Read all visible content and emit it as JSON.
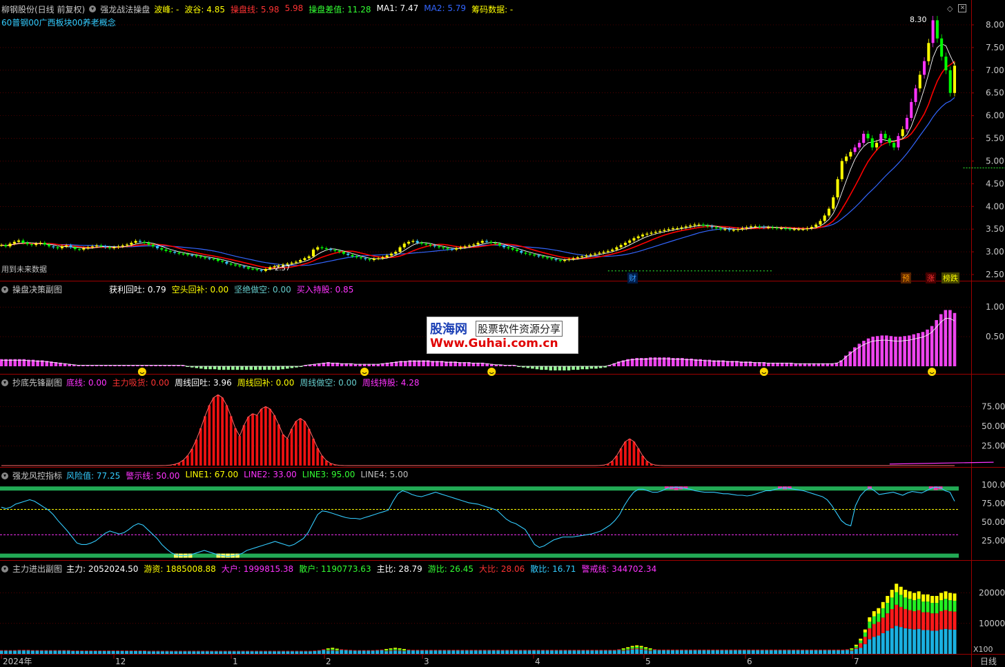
{
  "colors": {
    "bg": "#000000",
    "grid": "#8b0000",
    "axis": "#a00000",
    "up": "#ffff00",
    "down": "#00ff00",
    "magenta": "#ff33ff",
    "red": "#ff0000",
    "cyan": "#33ccff",
    "blue": "#3366ff",
    "white": "#ffffff"
  },
  "main": {
    "stock": "柳钢股份(日线 前复权)",
    "indicator": "强龙战法操盘",
    "items": [
      {
        "label": "波峰: -",
        "color": "#ffff00"
      },
      {
        "label": "波谷: 4.85",
        "color": "#ffff00"
      },
      {
        "label": "操盘线: 5.98",
        "color": "#ff3333"
      },
      {
        "label": "5.98",
        "color": "#ff3333"
      },
      {
        "label": "操盘差值: 11.28",
        "color": "#33ff33"
      },
      {
        "label": "MA1: 7.47",
        "color": "#ffffff"
      },
      {
        "label": "MA2: 5.79",
        "color": "#3366ff"
      },
      {
        "label": "筹码数据: -",
        "color": "#ffff00"
      }
    ],
    "concepts": "60普钢00广西板块00养老概念",
    "future_note": "用到未来数据",
    "peak_label": "8.30",
    "low_label": "2.57",
    "tags": [
      {
        "text": "财",
        "color": "#3399ff"
      },
      {
        "text": "预",
        "color": "#ff9900"
      },
      {
        "text": "涨",
        "color": "#ff3333"
      },
      {
        "text": "榜跌",
        "color": "#ffff00"
      }
    ]
  },
  "sub1": {
    "title": "操盘决策副图",
    "items": [
      {
        "label": "获利回吐: 0.79",
        "color": "#ffffff"
      },
      {
        "label": "空头回补: 0.00",
        "color": "#ffff00"
      },
      {
        "label": "坚绝做空: 0.00",
        "color": "#66cccc"
      },
      {
        "label": "买入持股: 0.85",
        "color": "#ff33ff"
      }
    ]
  },
  "sub2": {
    "title": "抄底先锋副图",
    "items": [
      {
        "label": "底线: 0.00",
        "color": "#ff33ff"
      },
      {
        "label": "主力吸货: 0.00",
        "color": "#ff3333"
      },
      {
        "label": "周线回吐: 3.96",
        "color": "#ffffff"
      },
      {
        "label": "周线回补: 0.00",
        "color": "#ffff00"
      },
      {
        "label": "周线做空: 0.00",
        "color": "#66cccc"
      },
      {
        "label": "周线持股: 4.28",
        "color": "#ff33ff"
      }
    ]
  },
  "sub3": {
    "title": "强龙风控指标",
    "items": [
      {
        "label": "风险值: 77.25",
        "color": "#33ccff"
      },
      {
        "label": "警示线: 50.00",
        "color": "#ff33ff"
      },
      {
        "label": "LINE1: 67.00",
        "color": "#ffff00"
      },
      {
        "label": "LINE2: 33.00",
        "color": "#ff33ff"
      },
      {
        "label": "LINE3: 95.00",
        "color": "#33ff33"
      },
      {
        "label": "LINE4: 5.00",
        "color": "#c0c0c0"
      }
    ]
  },
  "sub4": {
    "title": "主力进出副图",
    "items": [
      {
        "label": "主力: 2052024.50",
        "color": "#ffffff"
      },
      {
        "label": "游资: 1885008.88",
        "color": "#ffff00"
      },
      {
        "label": "大户: 1999815.38",
        "color": "#ff33ff"
      },
      {
        "label": "散户: 1190773.63",
        "color": "#33ff33"
      },
      {
        "label": "主比: 28.79",
        "color": "#ffffff"
      },
      {
        "label": "游比: 26.45",
        "color": "#33ff33"
      },
      {
        "label": "大比: 28.06",
        "color": "#ff3333"
      },
      {
        "label": "散比: 16.71",
        "color": "#33ccff"
      },
      {
        "label": "警戒线: 344702.34",
        "color": "#ff33ff"
      }
    ],
    "unit": "X100"
  },
  "period": "日线",
  "logo": {
    "cn": "股海网",
    "sub": "股票软件资源分享",
    "url": "Www.Guhai.com.cn"
  },
  "chart_data": [
    {
      "panel": "main",
      "type": "candlestick",
      "ylim": [
        2.5,
        8.0
      ],
      "yticks": [
        "8.00",
        "7.50",
        "7.00",
        "6.50",
        "6.00",
        "5.50",
        "5.00",
        "4.50",
        "4.00",
        "3.50",
        "3.00",
        "2.50"
      ],
      "xlabels": [
        "2024年",
        "12",
        "1",
        "2",
        "3",
        "4",
        "5",
        "6",
        "7"
      ],
      "close": [
        3.15,
        3.12,
        3.18,
        3.22,
        3.25,
        3.2,
        3.17,
        3.15,
        3.18,
        3.2,
        3.16,
        3.12,
        3.1,
        3.08,
        3.12,
        3.14,
        3.1,
        3.06,
        3.05,
        3.08,
        3.1,
        3.12,
        3.14,
        3.12,
        3.1,
        3.08,
        3.1,
        3.12,
        3.14,
        3.16,
        3.2,
        3.24,
        3.22,
        3.2,
        3.16,
        3.12,
        3.08,
        3.05,
        3.02,
        3.0,
        2.98,
        2.96,
        2.95,
        2.93,
        2.92,
        2.9,
        2.88,
        2.86,
        2.85,
        2.84,
        2.8,
        2.78,
        2.74,
        2.72,
        2.7,
        2.68,
        2.66,
        2.63,
        2.62,
        2.6,
        2.58,
        2.62,
        2.66,
        2.68,
        2.7,
        2.72,
        2.74,
        2.76,
        2.78,
        2.82,
        2.86,
        2.9,
        3.05,
        3.1,
        3.08,
        3.06,
        3.04,
        3.02,
        3.0,
        2.96,
        2.93,
        2.9,
        2.88,
        2.86,
        2.84,
        2.82,
        2.85,
        2.86,
        2.88,
        2.92,
        2.96,
        3.0,
        3.1,
        3.18,
        3.22,
        3.24,
        3.2,
        3.18,
        3.16,
        3.14,
        3.12,
        3.1,
        3.08,
        3.06,
        3.05,
        3.08,
        3.1,
        3.12,
        3.14,
        3.16,
        3.2,
        3.24,
        3.22,
        3.2,
        3.18,
        3.14,
        3.1,
        3.08,
        3.05,
        3.02,
        2.98,
        2.96,
        2.94,
        2.92,
        2.9,
        2.88,
        2.86,
        2.84,
        2.82,
        2.8,
        2.82,
        2.84,
        2.86,
        2.88,
        2.9,
        2.92,
        2.94,
        2.96,
        2.98,
        3.0,
        3.02,
        3.05,
        3.1,
        3.15,
        3.2,
        3.25,
        3.3,
        3.34,
        3.38,
        3.4,
        3.42,
        3.44,
        3.46,
        3.48,
        3.5,
        3.52,
        3.52,
        3.54,
        3.56,
        3.58,
        3.6,
        3.6,
        3.58,
        3.56,
        3.54,
        3.52,
        3.5,
        3.5,
        3.48,
        3.48,
        3.5,
        3.52,
        3.54,
        3.56,
        3.56,
        3.55,
        3.54,
        3.54,
        3.53,
        3.52,
        3.52,
        3.51,
        3.5,
        3.5,
        3.5,
        3.5,
        3.52,
        3.55,
        3.6,
        3.68,
        3.8,
        3.95,
        4.2,
        4.6,
        5.0,
        5.1,
        5.2,
        5.3,
        5.4,
        5.6,
        5.5,
        5.3,
        5.4,
        5.6,
        5.5,
        5.4,
        5.3,
        5.55,
        5.7,
        5.95,
        6.3,
        6.6,
        6.9,
        7.2,
        7.6,
        8.1,
        7.7,
        7.3,
        7.0,
        6.5,
        7.1
      ]
    },
    {
      "panel": "sub1",
      "type": "bar",
      "ylim": [
        0,
        1.2
      ],
      "yticks": [
        "1.00",
        "0.50"
      ],
      "values": [
        0.12,
        0.12,
        0.12,
        0.12,
        0.12,
        0.12,
        0.11,
        0.11,
        0.1,
        0.1,
        0.09,
        0.08,
        0.07,
        0.06,
        0.05,
        0.04,
        0.03,
        0.02,
        0.02,
        0.02,
        0.02,
        0.02,
        0.02,
        0.02,
        0.02,
        0.02,
        0.02,
        0.02,
        0.02,
        0.02,
        0.02,
        0.02,
        0.02,
        0.02,
        0.02,
        0.02,
        0.02,
        0.02,
        0.02,
        0.02,
        0.02,
        -0.01,
        -0.02,
        -0.03,
        -0.04,
        -0.05,
        -0.05,
        -0.05,
        -0.06,
        -0.06,
        -0.06,
        -0.06,
        -0.06,
        -0.06,
        -0.06,
        -0.06,
        -0.06,
        -0.06,
        -0.06,
        -0.06,
        -0.06,
        -0.06,
        -0.05,
        -0.04,
        -0.03,
        -0.02,
        -0.01,
        0.02,
        0.03,
        0.04,
        0.05,
        0.06,
        0.07,
        0.06,
        0.06,
        0.05,
        0.05,
        0.05,
        0.04,
        0.04,
        0.04,
        0.04,
        0.04,
        0.04,
        0.05,
        0.06,
        0.07,
        0.08,
        0.09,
        0.09,
        0.1,
        0.1,
        0.1,
        0.1,
        0.1,
        0.09,
        0.09,
        0.09,
        0.08,
        0.08,
        0.08,
        0.07,
        0.07,
        0.07,
        0.06,
        0.06,
        0.06,
        0.05,
        0.04,
        0.03,
        0.03,
        0.02,
        0.02,
        0.02,
        -0.01,
        -0.02,
        -0.03,
        -0.04,
        -0.05,
        -0.06,
        -0.06,
        -0.07,
        -0.07,
        -0.07,
        -0.07,
        -0.07,
        -0.06,
        -0.06,
        -0.05,
        -0.05,
        -0.04,
        -0.04,
        -0.03,
        -0.02,
        0.02,
        0.05,
        0.08,
        0.1,
        0.12,
        0.13,
        0.14,
        0.14,
        0.14,
        0.15,
        0.15,
        0.15,
        0.15,
        0.15,
        0.14,
        0.14,
        0.14,
        0.13,
        0.13,
        0.12,
        0.12,
        0.11,
        0.11,
        0.1,
        0.1,
        0.1,
        0.09,
        0.09,
        0.09,
        0.08,
        0.08,
        0.08,
        0.07,
        0.07,
        0.07,
        0.06,
        0.06,
        0.06,
        0.06,
        0.06,
        0.06,
        0.05,
        0.05,
        0.05,
        0.05,
        0.05,
        0.05,
        0.05,
        0.05,
        0.05,
        0.06,
        0.1,
        0.18,
        0.25,
        0.32,
        0.38,
        0.43,
        0.47,
        0.5,
        0.51,
        0.52,
        0.52,
        0.51,
        0.5,
        0.5,
        0.51,
        0.52,
        0.54,
        0.56,
        0.58,
        0.62,
        0.68,
        0.78,
        0.88,
        0.95,
        0.95,
        0.9
      ],
      "smileys_at": [
        31,
        80,
        108,
        168,
        205
      ]
    },
    {
      "panel": "sub2",
      "type": "bar",
      "ylim": [
        0,
        100
      ],
      "yticks": [
        "75.00",
        "50.00",
        "25.00"
      ],
      "peaks": [
        {
          "center": 50,
          "height": 90,
          "width": 5
        },
        {
          "center": 58,
          "height": 66,
          "width": 4
        },
        {
          "center": 61,
          "height": 75,
          "width": 5
        },
        {
          "center": 69,
          "height": 60,
          "width": 4
        },
        {
          "center": 145,
          "height": 34,
          "width": 3
        }
      ]
    },
    {
      "panel": "sub3",
      "type": "line",
      "ylim": [
        0,
        110
      ],
      "yticks": [
        "100.0",
        "75.00",
        "50.00",
        "25.00"
      ],
      "guide_lines": {
        "LINE1": 67,
        "LINE2": 33,
        "LINE3": 95,
        "LINE4": 5
      },
      "risk": [
        70,
        68,
        70,
        74,
        76,
        78,
        80,
        78,
        74,
        70,
        66,
        60,
        52,
        45,
        38,
        30,
        22,
        20,
        20,
        22,
        25,
        30,
        35,
        38,
        36,
        34,
        36,
        40,
        45,
        48,
        46,
        40,
        34,
        28,
        20,
        14,
        9,
        6,
        5,
        5,
        6,
        8,
        10,
        12,
        10,
        8,
        6,
        5,
        4,
        5,
        6,
        8,
        12,
        14,
        16,
        18,
        20,
        22,
        24,
        22,
        20,
        18,
        20,
        24,
        28,
        36,
        48,
        60,
        65,
        64,
        62,
        60,
        58,
        56,
        55,
        55,
        54,
        56,
        58,
        60,
        62,
        64,
        66,
        78,
        88,
        92,
        90,
        87,
        85,
        84,
        86,
        88,
        90,
        88,
        86,
        84,
        82,
        80,
        78,
        76,
        75,
        74,
        72,
        70,
        68,
        66,
        60,
        54,
        50,
        48,
        44,
        40,
        30,
        20,
        16,
        18,
        22,
        26,
        28,
        30,
        30,
        30,
        31,
        32,
        33,
        34,
        36,
        38,
        42,
        46,
        52,
        60,
        72,
        82,
        90,
        94,
        94,
        92,
        90,
        90,
        92,
        95,
        96,
        97,
        96,
        95,
        94,
        92,
        91,
        90,
        90,
        90,
        89,
        88,
        88,
        87,
        86,
        86,
        85,
        86,
        88,
        90,
        92,
        92,
        94,
        95,
        96,
        95,
        94,
        93,
        92,
        90,
        88,
        86,
        84,
        80,
        72,
        62,
        52,
        47,
        45,
        72,
        85,
        92,
        96,
        92,
        87,
        88,
        89,
        90,
        88,
        86,
        89,
        91,
        90,
        89,
        92,
        95,
        97,
        96,
        92,
        90,
        78
      ],
      "magenta_zone_ranges": [
        [
          150,
          168
        ],
        [
          176,
          180
        ]
      ]
    },
    {
      "panel": "sub4",
      "type": "stacked_bar",
      "ylim": [
        0,
        26000
      ],
      "yticks": [
        "20000",
        "10000"
      ],
      "series": [
        "主力",
        "游资",
        "大户",
        "散户"
      ],
      "stack_colors": [
        "#1ab0e0",
        "#ff1a1a",
        "#22ee22",
        "#ffff00"
      ],
      "main_trend": [
        1200,
        1200,
        1200,
        1200,
        1300,
        1300,
        1300,
        1200,
        1200,
        1200,
        1200,
        1200,
        1200,
        1200,
        1200,
        1200,
        1100,
        1100,
        1100,
        1100,
        1100,
        1100,
        1100,
        1100,
        1100,
        1100,
        1100,
        1100,
        1100,
        1100,
        1100,
        1100,
        1100,
        1000,
        1000,
        1000,
        1000,
        1000,
        1000,
        1000,
        1000,
        1000,
        1000,
        1000,
        1000,
        1000,
        1000,
        1000,
        1000,
        1000,
        1000,
        1000,
        1000,
        1000,
        1000,
        1000,
        1000,
        1000,
        1000,
        1000,
        1000,
        1000,
        1000,
        1000,
        1000,
        1000,
        1000,
        1000,
        1000,
        1000,
        1100,
        1200,
        1500,
        1800,
        2000,
        1700,
        1500,
        1400,
        1300,
        1200,
        1200,
        1200,
        1200,
        1200,
        1300,
        1400,
        1600,
        1800,
        2000,
        1800,
        1600,
        1400,
        1300,
        1300,
        1300,
        1300,
        1300,
        1300,
        1300,
        1300,
        1300,
        1300,
        1300,
        1300,
        1300,
        1300,
        1300,
        1300,
        1300,
        1300,
        1300,
        1300,
        1300,
        1300,
        1300,
        1300,
        1300,
        1300,
        1300,
        1300,
        1300,
        1300,
        1300,
        1300,
        1300,
        1300,
        1300,
        1300,
        1300,
        1300,
        1300,
        1300,
        1300,
        1300,
        1300,
        1300,
        1300,
        1300,
        1500,
        1800,
        2200,
        2600,
        2800,
        2600,
        2200,
        1800,
        1500,
        1400,
        1400,
        1400,
        1400,
        1400,
        1400,
        1400,
        1400,
        1400,
        1400,
        1400,
        1400,
        1400,
        1400,
        1400,
        1400,
        1400,
        1400,
        1400,
        1400,
        1400,
        1400,
        1400,
        1400,
        1400,
        1400,
        1400,
        1400,
        1400,
        1400,
        1400,
        1400,
        1400,
        1400,
        1400,
        1400,
        1400,
        1400,
        1400,
        1400,
        1400,
        1400,
        1500,
        1800,
        3000,
        5000,
        8000,
        12000,
        14000,
        15000,
        17000,
        19000,
        21000,
        23000,
        22000,
        21000,
        20500,
        20000,
        20500,
        19500,
        19500,
        19000,
        19000,
        20000,
        20500,
        20000,
        19800
      ]
    }
  ]
}
